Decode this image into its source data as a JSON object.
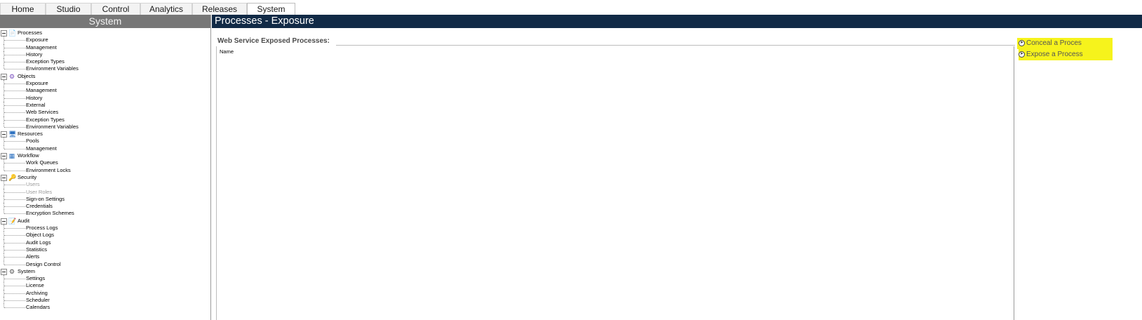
{
  "tabs": [
    {
      "label": "Home",
      "active": false
    },
    {
      "label": "Studio",
      "active": false
    },
    {
      "label": "Control",
      "active": false
    },
    {
      "label": "Analytics",
      "active": false
    },
    {
      "label": "Releases",
      "active": false
    },
    {
      "label": "System",
      "active": true
    }
  ],
  "sidebar": {
    "title": "System",
    "groups": [
      {
        "label": "Processes",
        "icon": "process-icon",
        "items": [
          {
            "label": "Exposure"
          },
          {
            "label": "Management"
          },
          {
            "label": "History"
          },
          {
            "label": "Exception Types"
          },
          {
            "label": "Environment Variables"
          }
        ]
      },
      {
        "label": "Objects",
        "icon": "objects-icon",
        "items": [
          {
            "label": "Exposure"
          },
          {
            "label": "Management"
          },
          {
            "label": "History"
          },
          {
            "label": "External"
          },
          {
            "label": "Web Services"
          },
          {
            "label": "Exception Types"
          },
          {
            "label": "Environment Variables"
          }
        ]
      },
      {
        "label": "Resources",
        "icon": "monitor-icon",
        "items": [
          {
            "label": "Pools"
          },
          {
            "label": "Management"
          }
        ]
      },
      {
        "label": "Workflow",
        "icon": "workflow-icon",
        "items": [
          {
            "label": "Work Queues"
          },
          {
            "label": "Environment Locks"
          }
        ]
      },
      {
        "label": "Security",
        "icon": "key-icon",
        "items": [
          {
            "label": "Users",
            "disabled": true
          },
          {
            "label": "User Roles",
            "disabled": true
          },
          {
            "label": "Sign-on Settings"
          },
          {
            "label": "Credentials"
          },
          {
            "label": "Encryption Schemes"
          }
        ]
      },
      {
        "label": "Audit",
        "icon": "audit-icon",
        "items": [
          {
            "label": "Process Logs"
          },
          {
            "label": "Object Logs"
          },
          {
            "label": "Audit Logs"
          },
          {
            "label": "Statistics"
          },
          {
            "label": "Alerts"
          },
          {
            "label": "Design Control"
          }
        ]
      },
      {
        "label": "System",
        "icon": "gears-icon",
        "items": [
          {
            "label": "Settings"
          },
          {
            "label": "License"
          },
          {
            "label": "Archiving"
          },
          {
            "label": "Scheduler"
          },
          {
            "label": "Calendars"
          }
        ]
      }
    ]
  },
  "main": {
    "title": "Processes - Exposure",
    "section_title": "Web Service Exposed Processes:",
    "column_header": "Name",
    "actions": [
      {
        "label": "Conceal a Proces",
        "icon": "arrow-right-circle-icon"
      },
      {
        "label": "Expose a Process",
        "icon": "arrow-right-circle-icon"
      }
    ]
  },
  "colors": {
    "header_dark": "#112a46",
    "sidebar_header": "#777777",
    "highlight": "#f6f31c"
  }
}
